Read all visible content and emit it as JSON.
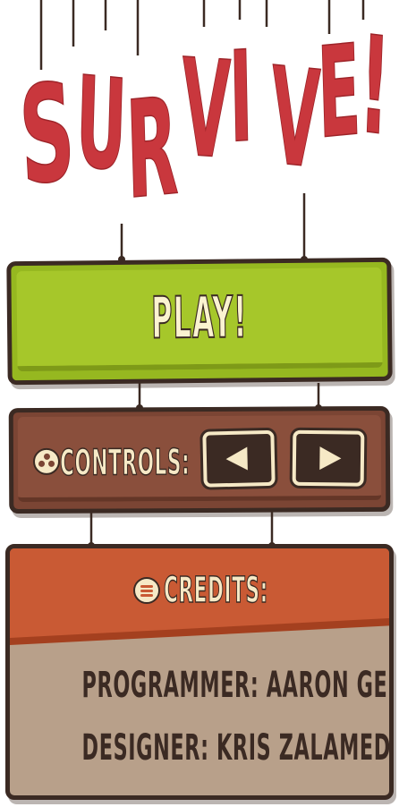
{
  "title": {
    "letters": [
      "S",
      "U",
      "R",
      "V",
      "I",
      "V",
      "E",
      "!"
    ],
    "color": "#c9373d"
  },
  "menu": {
    "play_label": "PLAY!",
    "play_color": "#a6c72a",
    "controls_label": "CONTROLS:",
    "controls_icon": "gamepad-icon",
    "controls_color": "#8a4f3c",
    "left_arrow_icon": "arrow-left-icon",
    "right_arrow_icon": "arrow-right-icon",
    "credits_label": "CREDITS:",
    "credits_icon": "list-icon",
    "credits_header_color": "#c95a34",
    "credits_body_color": "#b8a08a"
  },
  "credits": {
    "programmer": "PROGRAMMER: AARON GEISLER",
    "designer": "DESIGNER: KRIS ZALAMEDA"
  }
}
